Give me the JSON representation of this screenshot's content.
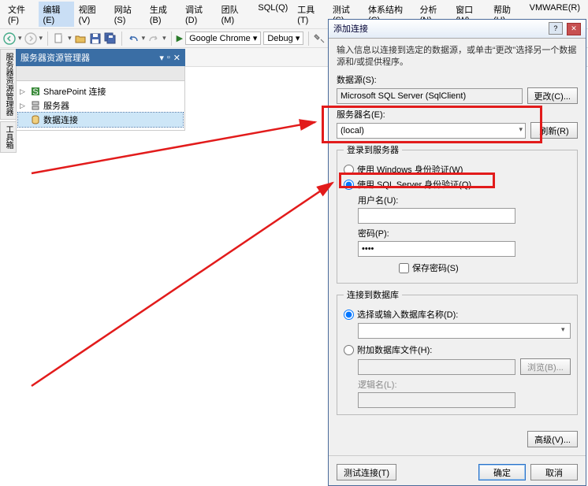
{
  "menu": {
    "items": [
      "文件(F)",
      "编辑(E)",
      "视图(V)",
      "网站(S)",
      "生成(B)",
      "调试(D)",
      "团队(M)",
      "SQL(Q)",
      "工具(T)",
      "测试(S)",
      "体系结构(C)",
      "分析(N)",
      "窗口(W)",
      "帮助(H)",
      "VMWARE(R)"
    ],
    "highlighted": 1
  },
  "toolbar": {
    "browser": "Google Chrome",
    "config": "Debug"
  },
  "side": {
    "title": "服务器资源管理器",
    "tree": [
      {
        "icon": "sp",
        "label": "SharePoint 连接"
      },
      {
        "icon": "srv",
        "label": "服务器"
      },
      {
        "icon": "db",
        "label": "数据连接",
        "selected": true
      }
    ]
  },
  "dialog": {
    "title": "添加连接",
    "desc": "输入信息以连接到选定的数据源，或单击“更改”选择另一个数据源和/或提供程序。",
    "datasource_label": "数据源(S):",
    "datasource_value": "Microsoft SQL Server (SqlClient)",
    "change_btn": "更改(C)...",
    "server_label": "服务器名(E):",
    "server_value": "(local)",
    "refresh_btn": "刷新(R)",
    "login_legend": "登录到服务器",
    "winauth": "使用 Windows 身份验证(W)",
    "sqlauth": "使用 SQL Server 身份验证(Q)",
    "user_label": "用户名(U):",
    "user_value": "",
    "pass_label": "密码(P):",
    "pass_value": "••••",
    "savepass": "保存密码(S)",
    "db_legend": "连接到数据库",
    "selectdb": "选择或输入数据库名称(D):",
    "db_value": "",
    "attachdb": "附加数据库文件(H):",
    "browse_btn": "浏览(B)...",
    "logical_label": "逻辑名(L):",
    "advanced_btn": "高级(V)...",
    "test_btn": "测试连接(T)",
    "ok_btn": "确定",
    "cancel_btn": "取消"
  }
}
